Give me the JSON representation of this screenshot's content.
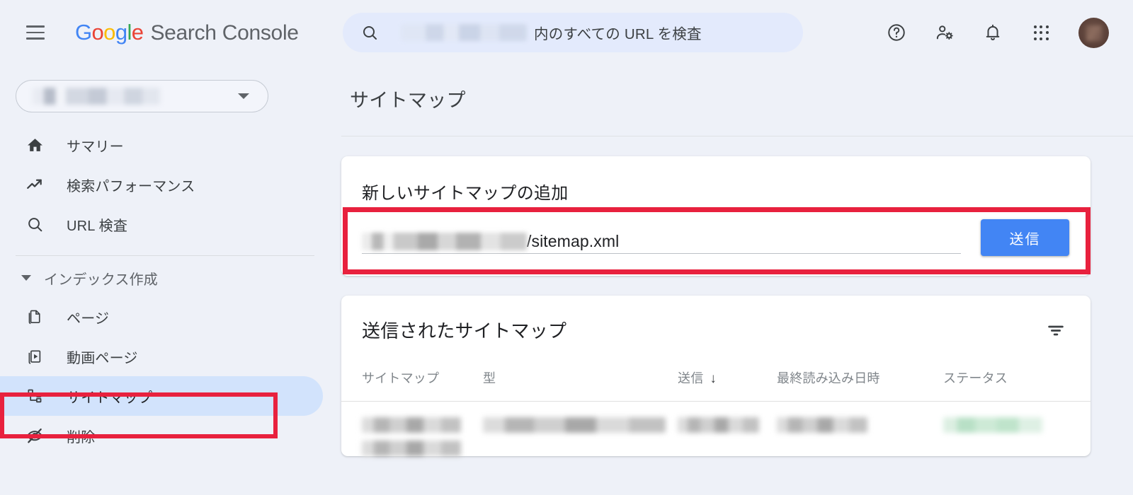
{
  "topbar": {
    "menu_icon": "hamburger-menu-icon",
    "logo": {
      "text": "Google",
      "letters": [
        "G",
        "o",
        "o",
        "g",
        "l",
        "e"
      ]
    },
    "product_name": "Search Console",
    "search": {
      "icon": "search-icon",
      "redacted_property": "",
      "placeholder_suffix": "内のすべての URL を検査"
    },
    "actions": [
      {
        "name": "help-icon",
        "label": "ヘルプ"
      },
      {
        "name": "account-settings-icon",
        "label": "設定"
      },
      {
        "name": "notifications-bell-icon",
        "label": "通知"
      },
      {
        "name": "apps-grid-icon",
        "label": "Google アプリ"
      }
    ],
    "avatar_label": "アカウント"
  },
  "sidebar": {
    "property_selector": {
      "redacted_value": "",
      "caret_icon": "chevron-down-icon"
    },
    "items": [
      {
        "label": "サマリー",
        "icon": "home-icon",
        "selected": false
      },
      {
        "label": "検索パフォーマンス",
        "icon": "trending-up-icon",
        "selected": false
      },
      {
        "label": "URL 検査",
        "icon": "search-icon",
        "selected": false
      }
    ],
    "group": {
      "label": "インデックス作成",
      "expanded": true,
      "caret_icon": "triangle-down-icon",
      "items": [
        {
          "label": "ページ",
          "icon": "pages-copy-icon",
          "selected": false
        },
        {
          "label": "動画ページ",
          "icon": "video-page-icon",
          "selected": false
        },
        {
          "label": "サイトマップ",
          "icon": "account-tree-icon",
          "selected": true
        },
        {
          "label": "削除",
          "icon": "visibility-off-icon",
          "selected": false
        }
      ]
    }
  },
  "main": {
    "page_title": "サイトマップ",
    "add_card": {
      "title": "新しいサイトマップの追加",
      "url_redacted_prefix": "",
      "url_value_visible": "/sitemap.xml",
      "submit_label": "送信"
    },
    "submitted_card": {
      "title": "送信されたサイトマップ",
      "filter_icon": "filter-list-icon",
      "columns": [
        {
          "label": "サイトマップ",
          "sorted": false
        },
        {
          "label": "型",
          "sorted": false
        },
        {
          "label": "送信",
          "sorted": true,
          "sort_arrow": "↓"
        },
        {
          "label": "最終読み込み日時",
          "sorted": false
        },
        {
          "label": "ステータス",
          "sorted": false
        }
      ],
      "rows": [
        {
          "sitemap": "",
          "type": "",
          "submitted": "",
          "last_read": "",
          "status": "",
          "redacted": true,
          "status_color": "#b8e0c6"
        }
      ]
    }
  },
  "annotations": {
    "highlight_color": "#e8213e",
    "boxes": [
      {
        "name": "sitemap-nav-highlight",
        "target": "sidebar-item-sitemap"
      },
      {
        "name": "add-sitemap-input-highlight",
        "target": "add-sitemap-row"
      }
    ]
  },
  "colors": {
    "background": "#eef1f8",
    "card": "#ffffff",
    "accent_blue": "#4285f4",
    "selected_nav": "#d2e3fc",
    "annotation_red": "#e8213e",
    "text_primary": "#202124",
    "text_secondary": "#5f6368",
    "text_muted": "#80868b"
  }
}
